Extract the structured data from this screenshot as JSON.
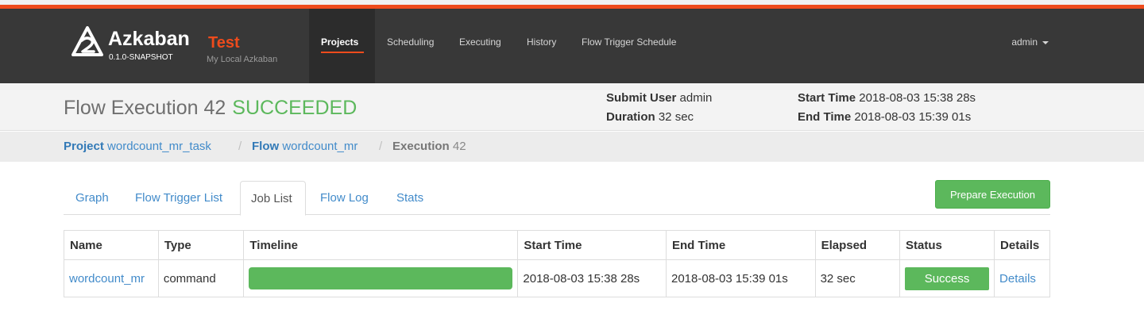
{
  "brand": {
    "name": "Azkaban",
    "version": "0.1.0-SNAPSHOT",
    "env_name": "Test",
    "env_desc": "My Local Azkaban"
  },
  "nav": {
    "items": [
      "Projects",
      "Scheduling",
      "Executing",
      "History",
      "Flow Trigger Schedule"
    ],
    "active": "Projects",
    "user": "admin"
  },
  "header": {
    "title": "Flow Execution 42",
    "status": "SUCCEEDED",
    "submit_user_label": "Submit User",
    "submit_user": "admin",
    "duration_label": "Duration",
    "duration": "32 sec",
    "start_time_label": "Start Time",
    "start_time": "2018-08-03 15:38 28s",
    "end_time_label": "End Time",
    "end_time": "2018-08-03 15:39 01s"
  },
  "breadcrumb": {
    "project_label": "Project",
    "project": "wordcount_mr_task",
    "flow_label": "Flow",
    "flow": "wordcount_mr",
    "execution_label": "Execution",
    "execution": "42"
  },
  "tabs": [
    "Graph",
    "Flow Trigger List",
    "Job List",
    "Flow Log",
    "Stats"
  ],
  "active_tab": "Job List",
  "prepare_button": "Prepare Execution",
  "table": {
    "headers": [
      "Name",
      "Type",
      "Timeline",
      "Start Time",
      "End Time",
      "Elapsed",
      "Status",
      "Details"
    ],
    "rows": [
      {
        "name": "wordcount_mr",
        "type": "command",
        "timeline_progress": 1.0,
        "start": "2018-08-03 15:38 28s",
        "end": "2018-08-03 15:39 01s",
        "elapsed": "32 sec",
        "status": "Success",
        "details": "Details"
      }
    ]
  },
  "colors": {
    "accent": "#ee4b1c",
    "navbar": "#383838",
    "success": "#5cb85c",
    "link": "#428bca"
  }
}
